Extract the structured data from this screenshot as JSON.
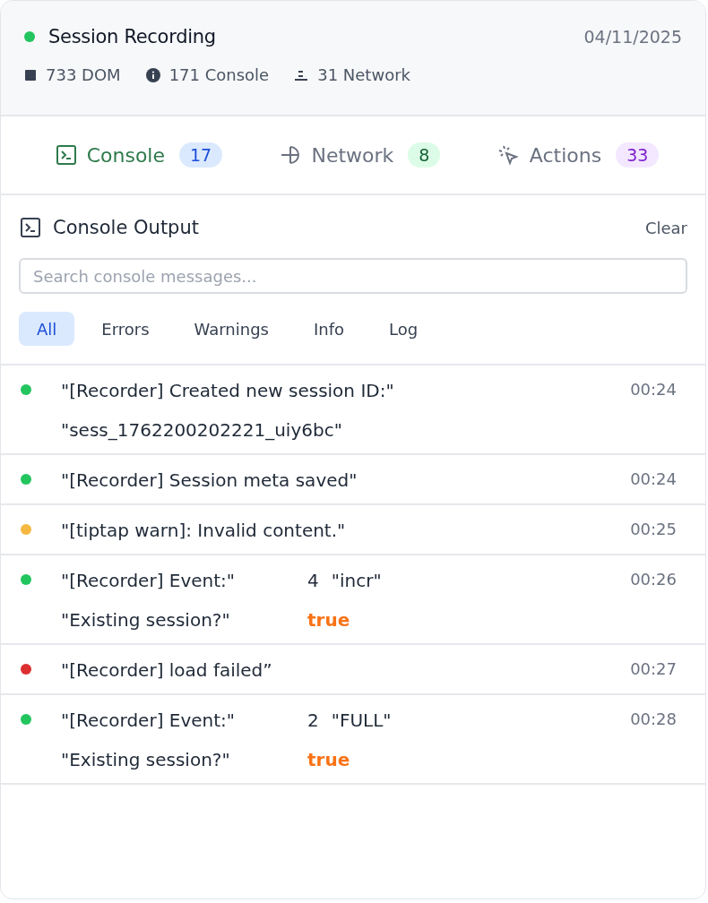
{
  "session": {
    "title": "Session Recording",
    "live": true,
    "date": "04/11/2025",
    "stats": [
      {
        "kind": "dom",
        "text": "733 DOM"
      },
      {
        "kind": "info",
        "text": "171 Console"
      },
      {
        "kind": "network",
        "text": "31 Network"
      }
    ]
  },
  "tabs": [
    {
      "kind": "console",
      "label": "Console",
      "count": "17",
      "selected": true
    },
    {
      "kind": "network",
      "label": "Network",
      "count": "8",
      "selected": false
    },
    {
      "kind": "actions",
      "label": "Actions",
      "count": "33",
      "selected": false
    }
  ],
  "panel": {
    "title": "Console Output",
    "clear": "Clear",
    "search": {
      "placeholder": "Search console messages..."
    },
    "filters": [
      {
        "label": "All",
        "selected": true
      },
      {
        "label": "Errors",
        "selected": false
      },
      {
        "label": "Warnings",
        "selected": false
      },
      {
        "label": "Info",
        "selected": false
      },
      {
        "label": "Log",
        "selected": false
      }
    ]
  },
  "entries": [
    {
      "color": "#22c55e",
      "time": "00:24",
      "lines": [
        {
          "message": "\"[Recorder] Created new session ID:\""
        },
        {
          "message": "\"sess_1762200202221_uiy6bc\""
        }
      ]
    },
    {
      "color": "#22c55e",
      "time": "00:24",
      "lines": [
        {
          "message": "\"[Recorder] Session meta saved\""
        }
      ]
    },
    {
      "color": "#f5b942",
      "time": "00:25",
      "lines": [
        {
          "message": "\"[tiptap warn]: Invalid content.\""
        }
      ]
    },
    {
      "color": "#22c55e",
      "time": "00:26",
      "lines": [
        {
          "message": "\"[Recorder] Event:\"",
          "args": [
            {
              "kind": "number",
              "text": "4"
            },
            {
              "kind": "string",
              "text": "\"incr\""
            }
          ]
        },
        {
          "message": "\"Existing session?\"",
          "args": [
            {
              "kind": "boolean",
              "text": "true"
            }
          ]
        }
      ]
    },
    {
      "color": "#dc2f2f",
      "time": "00:27",
      "lines": [
        {
          "message": "\"[Recorder] load failed”"
        }
      ]
    },
    {
      "color": "#22c55e",
      "time": "00:28",
      "lines": [
        {
          "message": "\"[Recorder] Event:\"",
          "args": [
            {
              "kind": "number",
              "text": "2"
            },
            {
              "kind": "string",
              "text": "\"FULL\""
            }
          ]
        },
        {
          "message": "\"Existing session?\"",
          "args": [
            {
              "kind": "boolean",
              "text": "true"
            }
          ]
        }
      ]
    }
  ]
}
